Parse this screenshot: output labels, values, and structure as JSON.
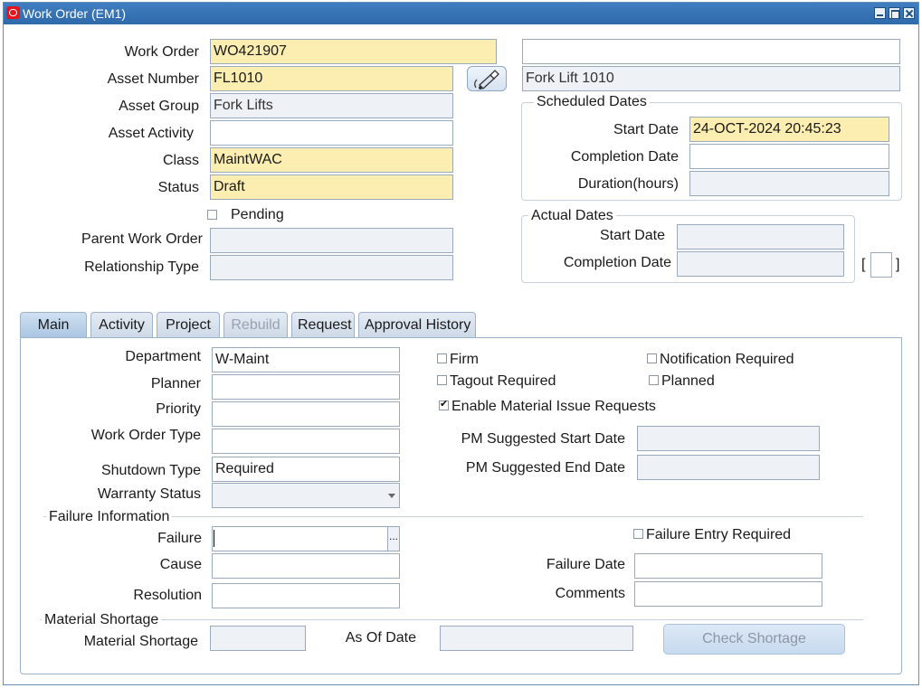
{
  "window": {
    "title": "Work Order (EM1)"
  },
  "header": {
    "work_order_label": "Work Order",
    "work_order": "WO421907",
    "work_order_desc": "",
    "asset_number_label": "Asset Number",
    "asset_number": "FL1010",
    "asset_desc": "Fork Lift 1010",
    "asset_group_label": "Asset Group",
    "asset_group": "Fork Lifts",
    "asset_activity_label": "Asset Activity",
    "asset_activity": "",
    "class_label": "Class",
    "class_value": "MaintWAC",
    "status_label": "Status",
    "status": "Draft",
    "pending_label": "Pending",
    "pending_checked": false,
    "parent_wo_label": "Parent Work Order",
    "parent_wo": "",
    "relationship_label": "Relationship Type",
    "relationship": ""
  },
  "scheduled": {
    "legend": "Scheduled Dates",
    "start_label": "Start Date",
    "start": "24-OCT-2024 20:45:23",
    "completion_label": "Completion Date",
    "completion": "",
    "duration_label": "Duration(hours)",
    "duration": ""
  },
  "actual": {
    "legend": "Actual Dates",
    "start_label": "Start Date",
    "start": "",
    "completion_label": "Completion Date",
    "completion": "",
    "bracket_open": "[",
    "bracket_close": "]"
  },
  "tabs": [
    {
      "label": "Main",
      "active": true
    },
    {
      "label": "Activity"
    },
    {
      "label": "Project"
    },
    {
      "label": "Rebuild",
      "disabled": true
    },
    {
      "label": "Request"
    },
    {
      "label": "Approval History"
    }
  ],
  "main": {
    "department_label": "Department",
    "department": "W-Maint",
    "planner_label": "Planner",
    "planner": "",
    "priority_label": "Priority",
    "priority": "",
    "wo_type_label": "Work Order Type",
    "wo_type": "",
    "shutdown_label": "Shutdown Type",
    "shutdown": "Required",
    "warranty_label": "Warranty Status",
    "warranty": "",
    "firm_label": "Firm",
    "notification_label": "Notification Required",
    "tagout_label": "Tagout Required",
    "planned_label": "Planned",
    "enable_mir_label": "Enable Material Issue Requests",
    "pm_start_label": "PM Suggested Start Date",
    "pm_start": "",
    "pm_end_label": "PM Suggested End Date",
    "pm_end": ""
  },
  "failure": {
    "legend": "Failure Information",
    "failure_label": "Failure",
    "failure": "",
    "cause_label": "Cause",
    "cause": "",
    "resolution_label": "Resolution",
    "resolution": "",
    "entry_required_label": "Failure Entry Required",
    "date_label": "Failure Date",
    "date": "",
    "comments_label": "Comments",
    "comments": "",
    "lov_button": "..."
  },
  "shortage": {
    "legend": "Material Shortage",
    "shortage_label": "Material Shortage",
    "shortage": "",
    "as_of_label": "As Of Date",
    "as_of": "",
    "check_button": "Check Shortage"
  },
  "icons": {
    "app": "oracle-logo-icon",
    "flashlight": "flashlight-icon"
  },
  "colors": {
    "titlebar": "#2f6aaa",
    "required_field": "#fcedb0",
    "readonly_field": "#eef1f5"
  }
}
